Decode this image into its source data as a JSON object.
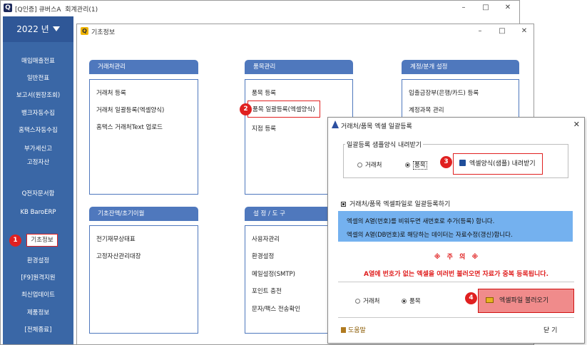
{
  "main_window": {
    "title": "[Q인증] 큐버스A  회계관리(1)",
    "controls": {
      "minimize": "–",
      "maximize": "□",
      "close": "✕"
    }
  },
  "sidebar": {
    "year_label": "2022 년",
    "items": [
      {
        "label": "매입매출전표"
      },
      {
        "label": "일반전표"
      },
      {
        "label": "보고서(원장조회)"
      },
      {
        "label": "뱅크자동수집"
      },
      {
        "label": "홈택스자동수집"
      },
      {
        "label": "부가세신고"
      },
      {
        "label": "고정자산"
      },
      {
        "label": "Q전자문서함"
      },
      {
        "label": "KB BaroERP"
      },
      {
        "label": "기초정보"
      },
      {
        "label": "환경설정"
      },
      {
        "label": "[F9]원격지원"
      },
      {
        "label": "최신업데이트"
      },
      {
        "label": "제품정보"
      },
      {
        "label": "[전체종료]"
      }
    ]
  },
  "info_window": {
    "logo": "Q",
    "title": "기초정보",
    "controls": {
      "minimize": "–",
      "maximize": "□",
      "close": "✕"
    },
    "sections": {
      "client": {
        "header": "거래처관리",
        "items": [
          "거래처 등록",
          "거래처 일괄등록(엑셀양식)",
          "홈택스 거래처Text 업로드"
        ]
      },
      "product": {
        "header": "품목관리",
        "items": [
          "품목 등록",
          "품목 일괄등록(엑셀양식)",
          "지점 등록"
        ]
      },
      "account": {
        "header": "계정/분개 설정",
        "items": [
          "입출금장부(은행/카드) 등록",
          "계정과목 관리"
        ]
      },
      "opening": {
        "header": "기초잔액/초기이월",
        "items": [
          "전기재무상태표",
          "고정자산관리대장"
        ]
      },
      "settings": {
        "header": "설 정 / 도 구",
        "items": [
          "사용자관리",
          "환경설정",
          "메일설정(SMTP)",
          "포인트 충전",
          "문자/팩스 전송확인"
        ]
      }
    }
  },
  "dialog": {
    "title": "거래처/품목 엑셀 일괄등록",
    "close": "✕",
    "sample_group_label": "일괄등록 샘플양식 내려받기",
    "sample_radios": {
      "client": "거래처",
      "product": "품목"
    },
    "download_button": "엑셀양식(샘플) 내려받기",
    "bulk_label": "거래처/품목 엑셀파일로 일괄등록하기",
    "info_lines": [
      "엑셀의 A열(번호)를 비워두면 새번호로 추가(등록) 합니다.",
      "엑셀의 A열(DB번호)로 해당하는 데이터는 자료수정(갱신)합니다."
    ],
    "warning_title": "※ 주 의 ※",
    "warning_text": "A열에 번호가 없는 엑셀을 여러번 불러오면 자료가 중복 등록됩니다.",
    "load_radios": {
      "client": "거래처",
      "product": "품목"
    },
    "load_button": "엑셀파일 불러오기",
    "help_link": "도움말",
    "close_button": "닫 기"
  },
  "callouts": [
    "1",
    "2",
    "3",
    "4"
  ],
  "colors": {
    "sidebar_bg": "#3a67a6",
    "section_header_bg": "#4f78bd",
    "info_panel_bg": "#74b1ef",
    "load_button_bg": "#f08b8b",
    "callout_red": "#e02020"
  }
}
